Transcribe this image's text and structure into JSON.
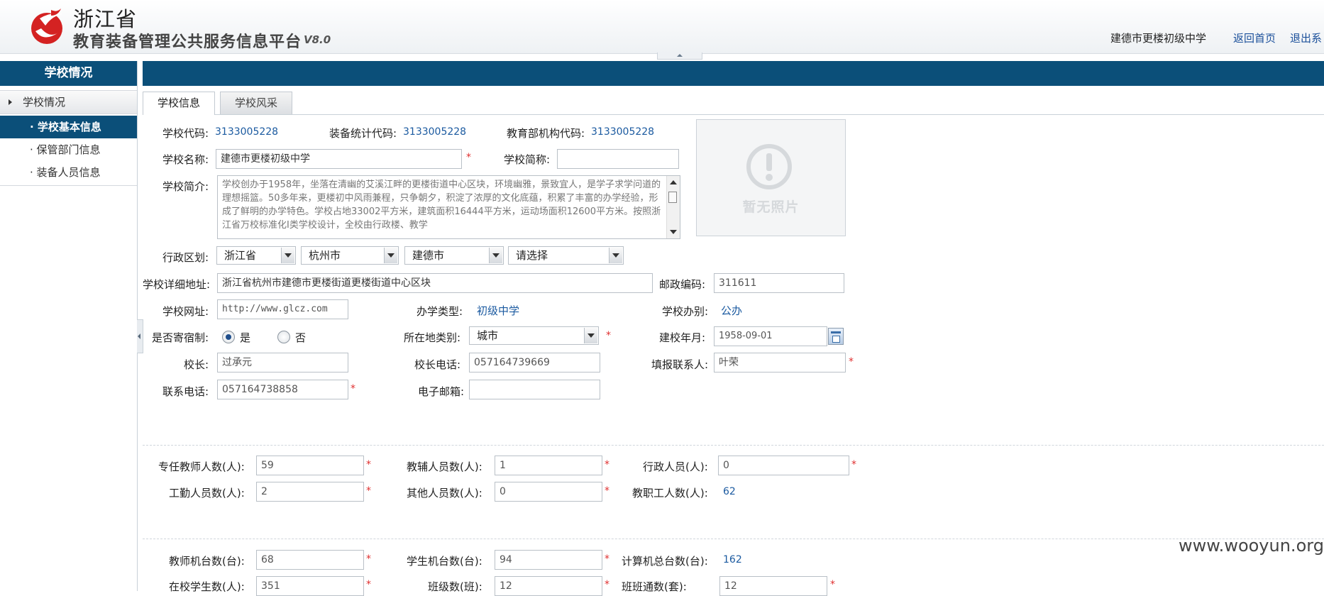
{
  "header": {
    "province": "浙江省",
    "platform": "教育装备管理公共服务信息平台",
    "version": "V8.0",
    "school": "建德市更楼初级中学",
    "home_link": "返回首页",
    "logout_link": "退出系"
  },
  "sidebar": {
    "title": "学校情况",
    "group": "学校情况",
    "items": [
      {
        "label": "· 学校基本信息"
      },
      {
        "label": "· 保管部门信息"
      },
      {
        "label": "· 装备人员信息"
      }
    ]
  },
  "tabs": [
    {
      "label": "学校信息"
    },
    {
      "label": "学校风采"
    }
  ],
  "form": {
    "school_code": {
      "label": "学校代码:",
      "value": "3133005228"
    },
    "stat_code": {
      "label": "装备统计代码:",
      "value": "3133005228"
    },
    "edu_code": {
      "label": "教育部机构代码:",
      "value": "3133005228"
    },
    "school_name": {
      "label": "学校名称:",
      "value": "建德市更楼初级中学"
    },
    "short_name": {
      "label": "学校简称:",
      "value": ""
    },
    "intro": {
      "label": "学校简介:",
      "value": "学校创办于1958年，坐落在清幽的艾溪江畔的更楼街道中心区块，环境幽雅，景致宜人，是学子求学问道的理想摇篮。50多年来，更楼初中风雨兼程，只争朝夕，积淀了浓厚的文化底蕴，积累了丰富的办学经验，形成了鲜明的办学特色。学校占地33002平方米，建筑面积16444平方米，运动场面积12600平方米。按照浙江省万校标准化Ⅰ类学校设计，全校由行政楼、教学"
    },
    "region": {
      "label": "行政区划:",
      "province": "浙江省",
      "city": "杭州市",
      "county": "建德市",
      "town": "请选择"
    },
    "address": {
      "label": "学校详细地址:",
      "value": "浙江省杭州市建德市更楼街道更楼街道中心区块"
    },
    "postcode": {
      "label": "邮政编码:",
      "value": "311611"
    },
    "website": {
      "label": "学校网址:",
      "value": "http://www.glcz.com"
    },
    "school_type": {
      "label": "办学类型:",
      "value": "初级中学"
    },
    "school_run": {
      "label": "学校办别:",
      "value": "公办"
    },
    "boarding": {
      "label": "是否寄宿制:",
      "yes": "是",
      "no": "否",
      "selected": "yes"
    },
    "location_type": {
      "label": "所在地类别:",
      "value": "城市"
    },
    "founded": {
      "label": "建校年月:",
      "value": "1958-09-01"
    },
    "principal": {
      "label": "校长:",
      "value": "过承元"
    },
    "principal_phone": {
      "label": "校长电话:",
      "value": "057164739669"
    },
    "contact": {
      "label": "填报联系人:",
      "value": "叶荣"
    },
    "phone": {
      "label": "联系电话:",
      "value": "057164738858"
    },
    "email": {
      "label": "电子邮箱:",
      "value": ""
    }
  },
  "staff": {
    "teachers": {
      "label": "专任教师人数(人):",
      "value": "59"
    },
    "assistants": {
      "label": "教辅人员数(人):",
      "value": "1"
    },
    "admins": {
      "label": "行政人员(人):",
      "value": "0"
    },
    "workers": {
      "label": "工勤人员数(人):",
      "value": "2"
    },
    "others": {
      "label": "其他人员数(人):",
      "value": "0"
    },
    "total": {
      "label": "教职工人数(人):",
      "value": "62"
    }
  },
  "equipment": {
    "teacher_pcs": {
      "label": "教师机台数(台):",
      "value": "68"
    },
    "student_pcs": {
      "label": "学生机台数(台):",
      "value": "94"
    },
    "total_pcs": {
      "label": "计算机总台数(台):",
      "value": "162"
    },
    "students": {
      "label": "在校学生数(人):",
      "value": "351"
    },
    "classes": {
      "label": "班级数(班):",
      "value": "12"
    },
    "class_sets": {
      "label": "班班通数(套):",
      "value": "12"
    }
  },
  "required_mark": "*",
  "photo_placeholder": "暂无照片",
  "watermark": "www.wooyun.org",
  "colors": {
    "accent": "#0b4f79",
    "link": "#1a4f9a",
    "required": "#e03030",
    "value": "#1b5aa0"
  }
}
